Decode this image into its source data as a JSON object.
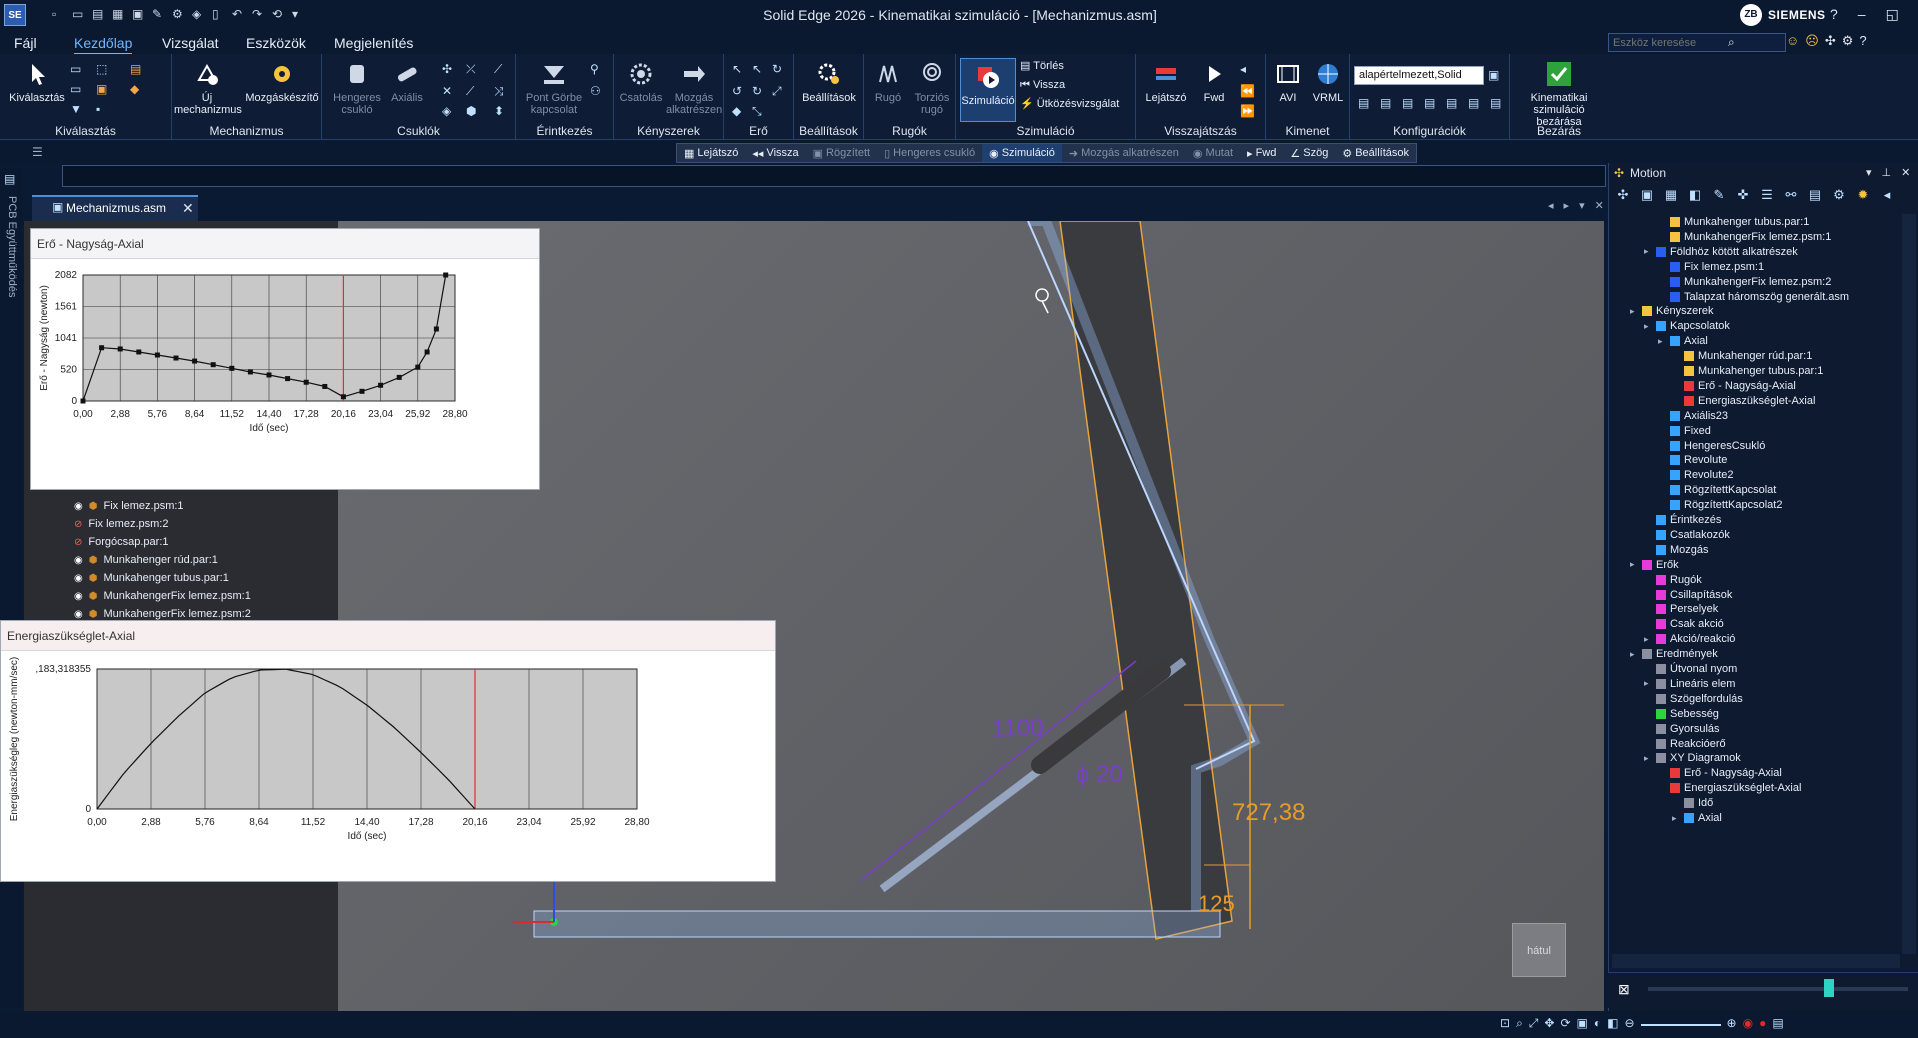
{
  "app": {
    "title": "Solid Edge 2026 - Kinematikai szimuláció - [Mechanizmus.asm]",
    "logo": "SE",
    "user_initials": "ZB",
    "brand": "SIEMENS",
    "window_controls": [
      "?",
      "–",
      "◱",
      "✕"
    ]
  },
  "menu": {
    "items": [
      "Fájl",
      "Kezdőlap",
      "Vizsgálat",
      "Eszközök",
      "Megjelenítés"
    ],
    "active": "Kezdőlap",
    "search_placeholder": "Eszköz keresése"
  },
  "ribbon": {
    "groups": [
      {
        "label": "Kiválasztás",
        "buttons": [
          "Kiválasztás"
        ]
      },
      {
        "label": "Mechanizmus",
        "buttons": [
          "Új mechanizmus",
          "Mozgáskészítő"
        ]
      },
      {
        "label": "Csuklók",
        "buttons": [
          "Hengeres csukló",
          "Axiális"
        ]
      },
      {
        "label": "Érintkezés",
        "buttons": [
          "Pont Görbe kapcsolat"
        ]
      },
      {
        "label": "Kényszerek",
        "buttons": [
          "Csatolás",
          "Mozgás alkatrészen"
        ]
      },
      {
        "label": "Erő",
        "buttons": []
      },
      {
        "label": "Beállítások",
        "buttons": [
          "Beállítások"
        ]
      },
      {
        "label": "Rugók",
        "buttons": [
          "Rugó",
          "Torziós rugó"
        ]
      },
      {
        "label": "Szimuláció",
        "buttons": [
          "Szimuláció",
          "Törlés",
          "Vissza",
          "Ütközésvizsgálat"
        ]
      },
      {
        "label": "Visszajátszás",
        "buttons": [
          "Lejátszó",
          "Fwd"
        ]
      },
      {
        "label": "Kimenet",
        "buttons": [
          "AVI",
          "VRML"
        ]
      },
      {
        "label": "Konfigurációk",
        "buttons": [
          "alapértelmezett,Solid"
        ]
      },
      {
        "label": "Bezárás",
        "buttons": [
          "Kinematikai szimuláció bezárása"
        ]
      }
    ]
  },
  "command_bar": {
    "items": [
      "Lejátszó",
      "Vissza",
      "Rögzített",
      "Hengeres csukló",
      "Szimuláció",
      "Mozgás alkatrészen",
      "Mutat",
      "Fwd",
      "Szög",
      "Beállítások"
    ]
  },
  "left_tab": {
    "label": "PCB Együttműködés"
  },
  "document": {
    "tab": "Mechanizmus.asm"
  },
  "pathfinder": {
    "rows": [
      {
        "label": "Fix lemez.psm:1",
        "status": "visible"
      },
      {
        "label": "Fix lemez.psm:2",
        "status": "hidden"
      },
      {
        "label": "Forgócsap.par:1",
        "status": "hidden"
      },
      {
        "label": "Munkahenger rúd.par:1",
        "status": "visible"
      },
      {
        "label": "Munkahenger tubus.par:1",
        "status": "visible"
      },
      {
        "label": "MunkahengerFix lemez.psm:1",
        "status": "visible"
      },
      {
        "label": "MunkahengerFix lemez.psm:2",
        "status": "visible"
      }
    ]
  },
  "viewport": {
    "dims": {
      "length": "1100",
      "diameter": "ϕ 20",
      "height": "727,38",
      "offset": "125"
    },
    "view_cube": "hátul"
  },
  "charts": {
    "force": {
      "window_title": "Erő - Nagyság-Axial"
    },
    "energy": {
      "window_title": "Energiaszükséglet-Axial"
    }
  },
  "chart_data": [
    {
      "type": "line",
      "title": "",
      "xlabel": "Idő (sec)",
      "ylabel": "Erő - Nagyság (newton)",
      "x_ticks": [
        "0,00",
        "2,88",
        "5,76",
        "8,64",
        "11,52",
        "14,40",
        "17,28",
        "20,16",
        "23,04",
        "25,92",
        "28,80"
      ],
      "y_ticks": [
        "0",
        "520",
        "1041",
        "1561",
        "2082"
      ],
      "xlim": [
        0,
        28.8
      ],
      "ylim": [
        0,
        2082
      ],
      "grid": true,
      "marker_line": 20.16,
      "x": [
        0.0,
        1.44,
        2.88,
        4.32,
        5.76,
        7.2,
        8.64,
        10.08,
        11.52,
        12.96,
        14.4,
        15.84,
        17.28,
        18.72,
        20.16,
        21.6,
        23.04,
        24.48,
        25.92,
        26.64,
        27.36,
        28.08
      ],
      "series": [
        {
          "values": [
            0,
            880,
            860,
            810,
            760,
            710,
            660,
            600,
            540,
            480,
            430,
            370,
            310,
            240,
            70,
            160,
            260,
            390,
            560,
            810,
            1190,
            2082
          ]
        }
      ]
    },
    {
      "type": "line",
      "title": "",
      "xlabel": "Idő (sec)",
      "ylabel": "Energiaszükségleg (newton-mm/sec)",
      "x_ticks": [
        "0,00",
        "2,88",
        "5,76",
        "8,64",
        "11,52",
        "14,40",
        "17,28",
        "20,16",
        "23,04",
        "25,92",
        "28,80"
      ],
      "y_ticks": [
        "0",
        ",183,318355"
      ],
      "xlim": [
        0,
        28.8
      ],
      "ylim": [
        0,
        0.183318355
      ],
      "grid": true,
      "marker_line": 20.16,
      "x": [
        0,
        1.44,
        2.88,
        4.32,
        5.76,
        7.2,
        8.64,
        10.08,
        11.52,
        12.96,
        14.4,
        15.84,
        17.28,
        18.72,
        20.16
      ],
      "series": [
        {
          "values": [
            0,
            0.047,
            0.086,
            0.121,
            0.152,
            0.172,
            0.182,
            0.183,
            0.176,
            0.16,
            0.136,
            0.107,
            0.074,
            0.039,
            0
          ]
        }
      ]
    }
  ],
  "motion_panel": {
    "title": "Motion",
    "tree": [
      {
        "label": "Munkahenger tubus.par:1",
        "level": 4,
        "icon": "part"
      },
      {
        "label": "MunkahengerFix lemez.psm:1",
        "level": 4,
        "icon": "part"
      },
      {
        "label": "Földhöz kötött alkatrészek",
        "level": 3,
        "icon": "ground"
      },
      {
        "label": "Fix lemez.psm:1",
        "level": 4,
        "icon": "ground"
      },
      {
        "label": "MunkahengerFix lemez.psm:2",
        "level": 4,
        "icon": "ground"
      },
      {
        "label": "Talapzat háromszög generált.asm",
        "level": 4,
        "icon": "ground"
      },
      {
        "label": "Kényszerek",
        "level": 2,
        "icon": "constraint"
      },
      {
        "label": "Kapcsolatok",
        "level": 3,
        "icon": "joint"
      },
      {
        "label": "Axial",
        "level": 4,
        "icon": "joint"
      },
      {
        "label": "Munkahenger rúd.par:1",
        "level": 5,
        "icon": "part"
      },
      {
        "label": "Munkahenger tubus.par:1",
        "level": 5,
        "icon": "part"
      },
      {
        "label": "Erő - Nagyság-Axial",
        "level": 5,
        "icon": "curve"
      },
      {
        "label": "Energiaszükséglet-Axial",
        "level": 5,
        "icon": "curve"
      },
      {
        "label": "Axiális23",
        "level": 4,
        "icon": "joint"
      },
      {
        "label": "Fixed",
        "level": 4,
        "icon": "joint"
      },
      {
        "label": "HengeresCsukló",
        "level": 4,
        "icon": "joint"
      },
      {
        "label": "Revolute",
        "level": 4,
        "icon": "joint"
      },
      {
        "label": "Revolute2",
        "level": 4,
        "icon": "joint"
      },
      {
        "label": "RögzítettKapcsolat",
        "level": 4,
        "icon": "joint"
      },
      {
        "label": "RögzítettKapcsolat2",
        "level": 4,
        "icon": "joint"
      },
      {
        "label": "Érintkezés",
        "level": 3,
        "icon": "joint"
      },
      {
        "label": "Csatlakozók",
        "level": 3,
        "icon": "joint"
      },
      {
        "label": "Mozgás",
        "level": 3,
        "icon": "joint"
      },
      {
        "label": "Erők",
        "level": 2,
        "icon": "force"
      },
      {
        "label": "Rugók",
        "level": 3,
        "icon": "force"
      },
      {
        "label": "Csillapítások",
        "level": 3,
        "icon": "force"
      },
      {
        "label": "Perselyek",
        "level": 3,
        "icon": "force"
      },
      {
        "label": "Csak akció",
        "level": 3,
        "icon": "force"
      },
      {
        "label": "Akció/reakció",
        "level": 3,
        "icon": "force"
      },
      {
        "label": "Eredmények",
        "level": 2,
        "icon": "result"
      },
      {
        "label": "Útvonal nyom",
        "level": 3,
        "icon": "result"
      },
      {
        "label": "Lineáris elem",
        "level": 3,
        "icon": "result"
      },
      {
        "label": "Szögelfordulás",
        "level": 3,
        "icon": "result"
      },
      {
        "label": "Sebesség",
        "level": 3,
        "icon": "green"
      },
      {
        "label": "Gyorsulás",
        "level": 3,
        "icon": "result"
      },
      {
        "label": "Reakcióerő",
        "level": 3,
        "icon": "result"
      },
      {
        "label": "XY Diagramok",
        "level": 3,
        "icon": "result"
      },
      {
        "label": "Erő - Nagyság-Axial",
        "level": 4,
        "icon": "curve"
      },
      {
        "label": "Energiaszükséglet-Axial",
        "level": 4,
        "icon": "curve"
      },
      {
        "label": "Idő",
        "level": 5,
        "icon": "result"
      },
      {
        "label": "Axial",
        "level": 5,
        "icon": "joint"
      }
    ]
  },
  "colors": {
    "accent": "#6fb8ff",
    "chart_bg": "#c8c8c8",
    "marker": "#e03030",
    "dim_purple": "#7a3fc8",
    "dim_orange": "#e89b2a"
  }
}
